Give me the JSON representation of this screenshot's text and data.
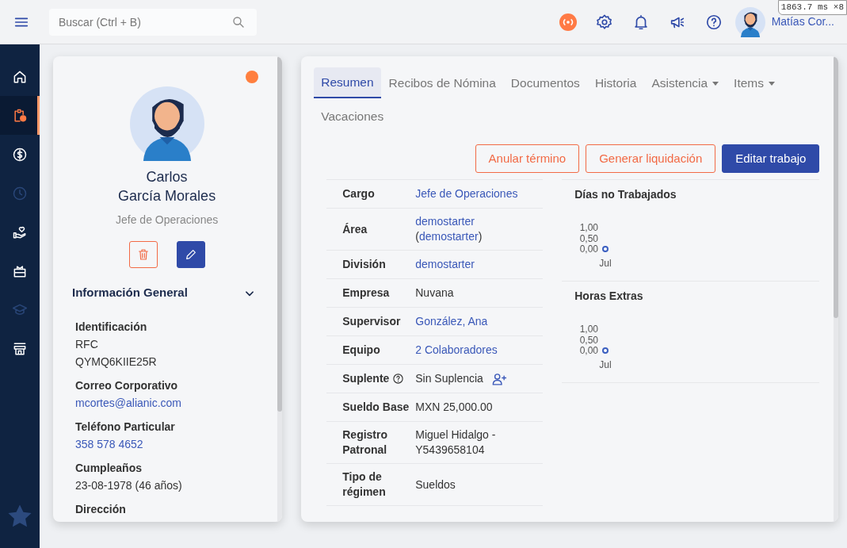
{
  "topbar": {
    "search": {
      "placeholder": "Buscar (Ctrl + B)"
    },
    "user_name": "Matías Cor...",
    "perf_overlay": "1863.7 ms ×8"
  },
  "sidebar": {
    "items": [
      {
        "selected": false,
        "disabled": false
      },
      {
        "selected": true,
        "disabled": false
      },
      {
        "selected": false,
        "disabled": false
      },
      {
        "selected": false,
        "disabled": true
      },
      {
        "selected": false,
        "disabled": false
      },
      {
        "selected": false,
        "disabled": false
      },
      {
        "selected": false,
        "disabled": true
      },
      {
        "selected": false,
        "disabled": false
      }
    ]
  },
  "profile": {
    "active": true,
    "first_name": "Carlos",
    "last_names": "García Morales",
    "job_title": "Jefe de Operaciones",
    "section": {
      "title": "Información General",
      "expanded": true,
      "fields": [
        {
          "label": "Identificación",
          "lines": [
            "RFC",
            "QYMQ6KIIE25R"
          ],
          "kind": "plain"
        },
        {
          "label": "Correo Corporativo",
          "lines": [
            "mcortes@alianic.com"
          ],
          "kind": "link"
        },
        {
          "label": "Teléfono Particular",
          "lines": [
            "358 578 4652"
          ],
          "kind": "link"
        },
        {
          "label": "Cumpleaños",
          "lines": [
            "23-08-1978 (46 años)"
          ],
          "kind": "plain"
        },
        {
          "label": "Dirección",
          "kind": "plain"
        }
      ]
    }
  },
  "tabs": [
    {
      "label": "Resumen",
      "selected": true,
      "dropdown": false
    },
    {
      "label": "Recibos de Nómina",
      "selected": false,
      "dropdown": false
    },
    {
      "label": "Documentos",
      "selected": false,
      "dropdown": false
    },
    {
      "label": "Historia",
      "selected": false,
      "dropdown": false
    },
    {
      "label": "Asistencia",
      "selected": false,
      "dropdown": true
    },
    {
      "label": "Items",
      "selected": false,
      "dropdown": true
    },
    {
      "label": "Vacaciones",
      "selected": false,
      "dropdown": false
    }
  ],
  "actions": [
    {
      "label": "Anular término",
      "kind": "outline"
    },
    {
      "label": "Generar liquidación",
      "kind": "outline"
    },
    {
      "label": "Editar trabajo",
      "kind": "primary"
    }
  ],
  "details": [
    {
      "label": "Cargo",
      "lines": [
        [
          {
            "text": "Jefe de Operaciones",
            "kind": "link"
          }
        ]
      ]
    },
    {
      "label": "Área",
      "lines": [
        [
          {
            "text": "demostarter",
            "kind": "link"
          }
        ],
        [
          {
            "text": "(",
            "kind": "plain"
          },
          {
            "text": "demostarter",
            "kind": "link"
          },
          {
            "text": ")",
            "kind": "plain"
          }
        ]
      ]
    },
    {
      "label": "División",
      "lines": [
        [
          {
            "text": "demostarter",
            "kind": "link"
          }
        ]
      ]
    },
    {
      "label": "Empresa",
      "lines": [
        [
          {
            "text": "Nuvana",
            "kind": "plain"
          }
        ]
      ]
    },
    {
      "label": "Supervisor",
      "lines": [
        [
          {
            "text": "González, Ana",
            "kind": "link"
          }
        ]
      ]
    },
    {
      "label": "Equipo",
      "lines": [
        [
          {
            "text": "2 Colaboradores",
            "kind": "link"
          }
        ]
      ]
    },
    {
      "label": "Suplente",
      "help": true,
      "assign": true,
      "lines": [
        [
          {
            "text": "Sin Suplencia",
            "kind": "plain"
          }
        ]
      ]
    },
    {
      "label": "Sueldo Base",
      "lines": [
        [
          {
            "text": "MXN 25,000.00",
            "kind": "plain"
          }
        ]
      ]
    },
    {
      "label": "Registro Patronal",
      "lines": [
        [
          {
            "text": "Miguel Hidalgo -",
            "kind": "plain"
          }
        ],
        [
          {
            "text": "Y5439658104",
            "kind": "plain"
          }
        ]
      ]
    },
    {
      "label": "Tipo de régimen",
      "lines": [
        [
          {
            "text": "Sueldos",
            "kind": "plain"
          }
        ]
      ]
    }
  ],
  "charts": [
    {
      "title": "Días no Trabajados",
      "chart_data": {
        "type": "line",
        "categories": [
          "Jul"
        ],
        "series": [
          {
            "color": "#3b5fc0",
            "marker": "circle",
            "values": [
              0
            ]
          }
        ],
        "ylim": [
          0,
          1
        ],
        "yticks": [
          {
            "value": 0,
            "label": "0,00"
          },
          {
            "value": 0.5,
            "label": "0,50"
          },
          {
            "value": 1,
            "label": "1,00"
          }
        ]
      }
    },
    {
      "title": "Horas Extras",
      "chart_data": {
        "type": "line",
        "categories": [
          "Jul"
        ],
        "series": [
          {
            "color": "#3b5fc0",
            "marker": "circle",
            "values": [
              0
            ]
          }
        ],
        "ylim": [
          0,
          1
        ],
        "yticks": [
          {
            "value": 0,
            "label": "0,00"
          },
          {
            "value": 0.5,
            "label": "0,50"
          },
          {
            "value": 1,
            "label": "1,00"
          }
        ]
      }
    }
  ]
}
